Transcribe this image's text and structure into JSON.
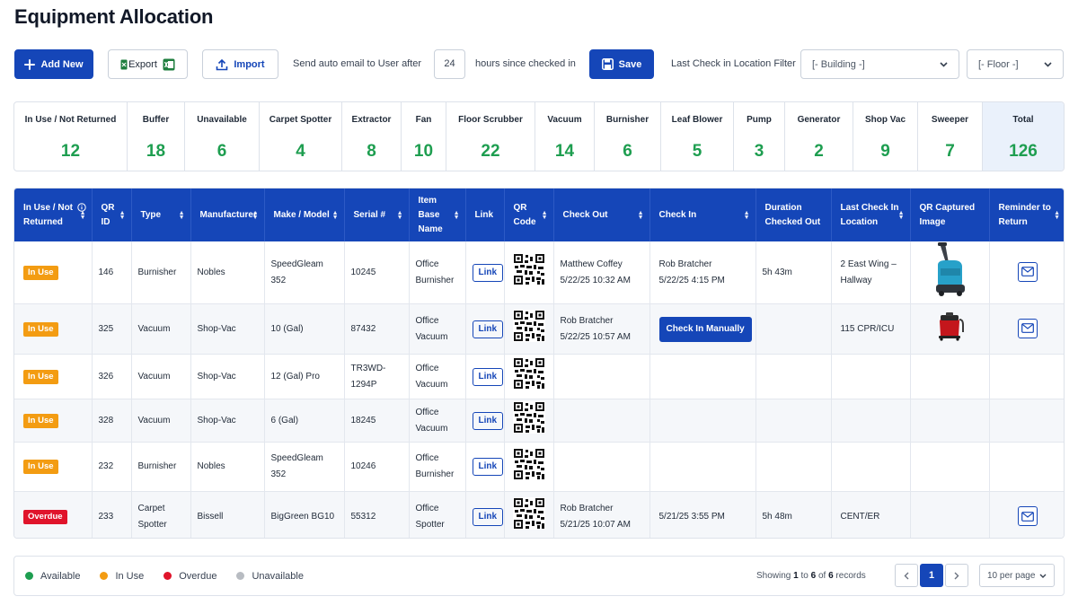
{
  "page": {
    "title": "Equipment Allocation"
  },
  "toolbar": {
    "add_new": "Add New",
    "export": "Export",
    "import": "Import",
    "auto_email_prefix": "Send auto email to User after",
    "auto_email_hours": "24",
    "auto_email_suffix": "hours since checked in",
    "save": "Save",
    "filter_label": "Last Check in Location Filter",
    "building_select": "[- Building -]",
    "floor_select": "[- Floor -]"
  },
  "summary": [
    {
      "label": "In Use / Not Returned",
      "value": "12"
    },
    {
      "label": "Buffer",
      "value": "18"
    },
    {
      "label": "Unavailable",
      "value": "6"
    },
    {
      "label": "Carpet Spotter",
      "value": "4"
    },
    {
      "label": "Extractor",
      "value": "8"
    },
    {
      "label": "Fan",
      "value": "10"
    },
    {
      "label": "Floor Scrubber",
      "value": "22"
    },
    {
      "label": "Vacuum",
      "value": "14"
    },
    {
      "label": "Burnisher",
      "value": "6"
    },
    {
      "label": "Leaf Blower",
      "value": "5"
    },
    {
      "label": "Pump",
      "value": "3"
    },
    {
      "label": "Generator",
      "value": "2"
    },
    {
      "label": "Shop Vac",
      "value": "9"
    },
    {
      "label": "Sweeper",
      "value": "7"
    },
    {
      "label": "Total",
      "value": "126"
    }
  ],
  "table": {
    "columns": [
      "In Use / Not Returned",
      "QR ID",
      "Type",
      "Manufacturer",
      "Make / Model",
      "Serial #",
      "Item Base Name",
      "Link",
      "QR Code",
      "Check Out",
      "Check In",
      "Duration Checked Out",
      "Last Check In Location",
      "QR Captured Image",
      "Reminder to Return"
    ],
    "link_label": "Link",
    "check_in_manually_label": "Check In Manually",
    "rows": [
      {
        "status": "In Use",
        "status_kind": "inuse",
        "qr_id": "146",
        "type": "Burnisher",
        "manufacturer": "Nobles",
        "model": "SpeedGleam 352",
        "serial": "10245",
        "base": "Office Burnisher",
        "checkout_user": "Matthew Coffey",
        "checkout_time": "5/22/25 10:32 AM",
        "checkin_user": "Rob Bratcher",
        "checkin_time": "5/22/25 4:15 PM",
        "duration": "5h 43m",
        "location": "2 East Wing – Hallway",
        "image": "scrubber",
        "reminder": true
      },
      {
        "status": "In Use",
        "status_kind": "inuse",
        "qr_id": "325",
        "type": "Vacuum",
        "manufacturer": "Shop-Vac",
        "model": "10 (Gal)",
        "serial": "87432",
        "base": "Office Vacuum",
        "checkout_user": "Rob Bratcher",
        "checkout_time": "5/22/25 10:57 AM",
        "checkin_manual": true,
        "duration": "",
        "location": "115 CPR/ICU",
        "image": "shopvac",
        "reminder": true
      },
      {
        "status": "In Use",
        "status_kind": "inuse",
        "qr_id": "326",
        "type": "Vacuum",
        "manufacturer": "Shop-Vac",
        "model": "12 (Gal) Pro",
        "serial": "TR3WD-1294P",
        "base": "Office Vacuum",
        "duration": "",
        "location": "",
        "reminder": false
      },
      {
        "status": "In Use",
        "status_kind": "inuse",
        "qr_id": "328",
        "type": "Vacuum",
        "manufacturer": "Shop-Vac",
        "model": "6 (Gal)",
        "serial": "18245",
        "base": "Office Vacuum",
        "duration": "",
        "location": "",
        "reminder": false
      },
      {
        "status": "In Use",
        "status_kind": "inuse",
        "qr_id": "232",
        "type": "Burnisher",
        "manufacturer": "Nobles",
        "model": "SpeedGleam 352",
        "serial": "10246",
        "base": "Office Burnisher",
        "duration": "",
        "location": "",
        "reminder": false
      },
      {
        "status": "Overdue",
        "status_kind": "overdue",
        "qr_id": "233",
        "type": "Carpet Spotter",
        "manufacturer": "Bissell",
        "model": "BigGreen BG10",
        "serial": "55312",
        "base": "Office Spotter",
        "checkout_user": "Rob Bratcher",
        "checkout_time": "5/21/25 10:07 AM",
        "checkin_time": "5/21/25 3:55 PM",
        "duration": "5h 48m",
        "location": "CENT/ER",
        "reminder": true
      }
    ]
  },
  "legend": [
    {
      "label": "Available",
      "color": "#1e9e50"
    },
    {
      "label": "In Use",
      "color": "#f39c12"
    },
    {
      "label": "Overdue",
      "color": "#e0142b"
    },
    {
      "label": "Unavailable",
      "color": "#b8bcc2"
    }
  ],
  "pagination": {
    "showing_prefix": "Showing",
    "from": "1",
    "to_word": "to",
    "to": "6",
    "of_word": "of",
    "total": "6",
    "records_word": "records",
    "current_page": "1",
    "per_page": "10 per page"
  },
  "colors": {
    "primary": "#1546b8",
    "success": "#1e9e50",
    "warning": "#f39c12",
    "danger": "#e0142b"
  }
}
